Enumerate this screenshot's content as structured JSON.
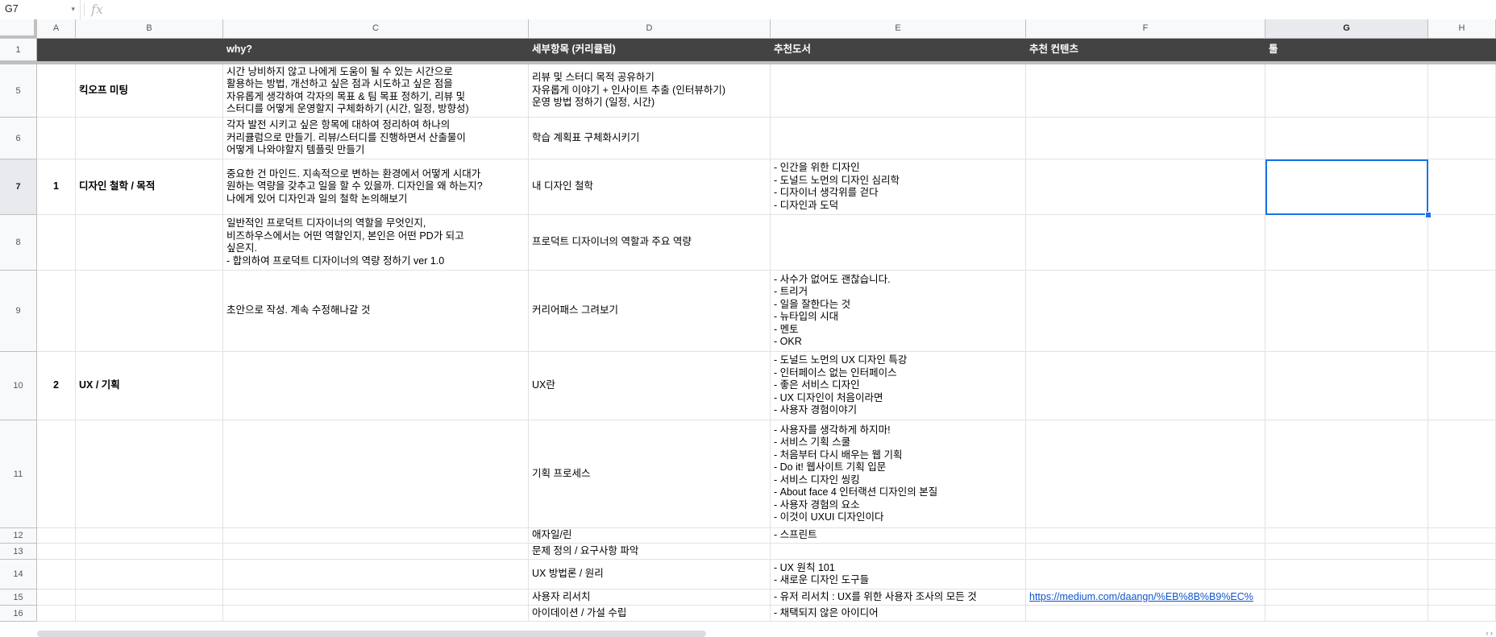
{
  "formula_bar": {
    "name_box": "G7",
    "fx_label": "fx",
    "value": ""
  },
  "columns": [
    "A",
    "B",
    "C",
    "D",
    "E",
    "F",
    "G",
    "H"
  ],
  "rows": [
    {
      "num": "1",
      "a": "",
      "b": "",
      "c": "why?",
      "d": "세부항목 (커리큘럼)",
      "e": "추천도서",
      "f": "추천 컨텐츠",
      "g": "툴",
      "h": ""
    },
    {
      "num": "5",
      "a": "",
      "b": "킥오프 미팅",
      "c": "시간 낭비하지 않고 나에게 도움이 될 수 있는 시간으로\n활용하는 방법, 개선하고 싶은 점과 시도하고 싶은 점을\n자유롭게 생각하여 각자의 목표 & 팀 목표 정하기, 리뷰 및\n스터디를 어떻게 운영할지 구체화하기 (시간, 일정, 방향성)",
      "d": "리뷰 및 스터디 목적 공유하기\n자유롭게 이야기 + 인사이트 추출 (인터뷰하기)\n운영 방법 정하기 (일정, 시간)",
      "e": "",
      "f": "",
      "g": "",
      "h": ""
    },
    {
      "num": "6",
      "a": "",
      "b": "",
      "c": "각자 발전 시키고 싶은 항목에 대하여 정리하여 하나의\n커리큘럼으로 만들기. 리뷰/스터디를 진행하면서 산출물이\n어떻게 나와야할지 템플릿 만들기",
      "d": "학습 계획표 구체화시키기",
      "e": "",
      "f": "",
      "g": "",
      "h": ""
    },
    {
      "num": "7",
      "a": "1",
      "b": "디자인 철학 / 목적",
      "c": "중요한 건 마인드. 지속적으로 변하는 환경에서 어떻게 시대가\n원하는 역량을 갖추고 일을 할 수 있을까. 디자인을 왜 하는지?\n나에게 있어 디자인과 일의 철학 논의해보기",
      "d": "내 디자인 철학",
      "e": "- 인간을 위한 디자인\n- 도널드 노먼의 디자인 심리학\n- 디자이너 생각위를 걷다\n- 디자인과 도덕",
      "f": "",
      "g": "",
      "h": ""
    },
    {
      "num": "8",
      "a": "",
      "b": "",
      "c": "일반적인 프로덕트 디자이너의 역할을 무엇인지,\n비즈하우스에서는 어떤 역할인지, 본인은 어떤 PD가 되고\n싶은지.\n- 합의하여 프로덕트 디자이너의 역량 정하기 ver 1.0",
      "d": "프로덕트 디자이너의 역할과 주요 역량",
      "e": "",
      "f": "",
      "g": "",
      "h": ""
    },
    {
      "num": "9",
      "a": "",
      "b": "",
      "c": "초안으로 작성. 계속 수정해나갈 것",
      "d": "커리어패스 그려보기",
      "e": "- 사수가 없어도 괜찮습니다.\n- 트리거\n- 일을 잘한다는 것\n- 뉴타입의 시대\n- 멘토\n- OKR",
      "f": "",
      "g": "",
      "h": ""
    },
    {
      "num": "10",
      "a": "2",
      "b": "UX / 기획",
      "c": "",
      "d": "UX란",
      "e": "- 도널드 노먼의 UX 디자인 특강\n- 인터페이스 없는 인터페이스\n- 좋은 서비스 디자인\n- UX 디자인이 처음이라면\n- 사용자 경험이야기",
      "f": "",
      "g": "",
      "h": ""
    },
    {
      "num": "11",
      "a": "",
      "b": "",
      "c": "",
      "d": "기획 프로세스",
      "e": "- 사용자를 생각하게 하지마!\n- 서비스 기획 스쿨\n- 처음부터 다시 배우는 웹 기획\n- Do it! 웹사이트 기획 입문\n- 서비스 디자인 씽킹\n- About face 4 인터랙션 디자인의 본질\n- 사용자 경험의 요소\n- 이것이 UXUI 디자인이다",
      "f": "",
      "g": "",
      "h": ""
    },
    {
      "num": "12",
      "a": "",
      "b": "",
      "c": "",
      "d": "애자일/린",
      "e": "- 스프린트",
      "f": "",
      "g": "",
      "h": ""
    },
    {
      "num": "13",
      "a": "",
      "b": "",
      "c": "",
      "d": "문제 정의 / 요구사항 파악",
      "e": "",
      "f": "",
      "g": "",
      "h": ""
    },
    {
      "num": "14",
      "a": "",
      "b": "",
      "c": "",
      "d": "UX 방법론 / 원리",
      "e": "- UX 원칙 101\n- 새로운 디자인 도구들",
      "f": "",
      "g": "",
      "h": ""
    },
    {
      "num": "15",
      "a": "",
      "b": "",
      "c": "",
      "d": "사용자 리서치",
      "e": "- 유저 리서치 : UX를 위한 사용자 조사의 모든 것",
      "f": "https://medium.com/daangn/%EB%8B%B9%EC%",
      "g": "",
      "h": ""
    },
    {
      "num": "16",
      "a": "",
      "b": "",
      "c": "",
      "d": "아이데이션 / 가설 수립",
      "e": "- 채택되지 않은 아이디어",
      "f": "",
      "g": "",
      "h": ""
    }
  ],
  "selected_cell": "G7",
  "header_row_color": "#434343",
  "selection_color": "#1a73e8",
  "link_color": "#1155cc"
}
